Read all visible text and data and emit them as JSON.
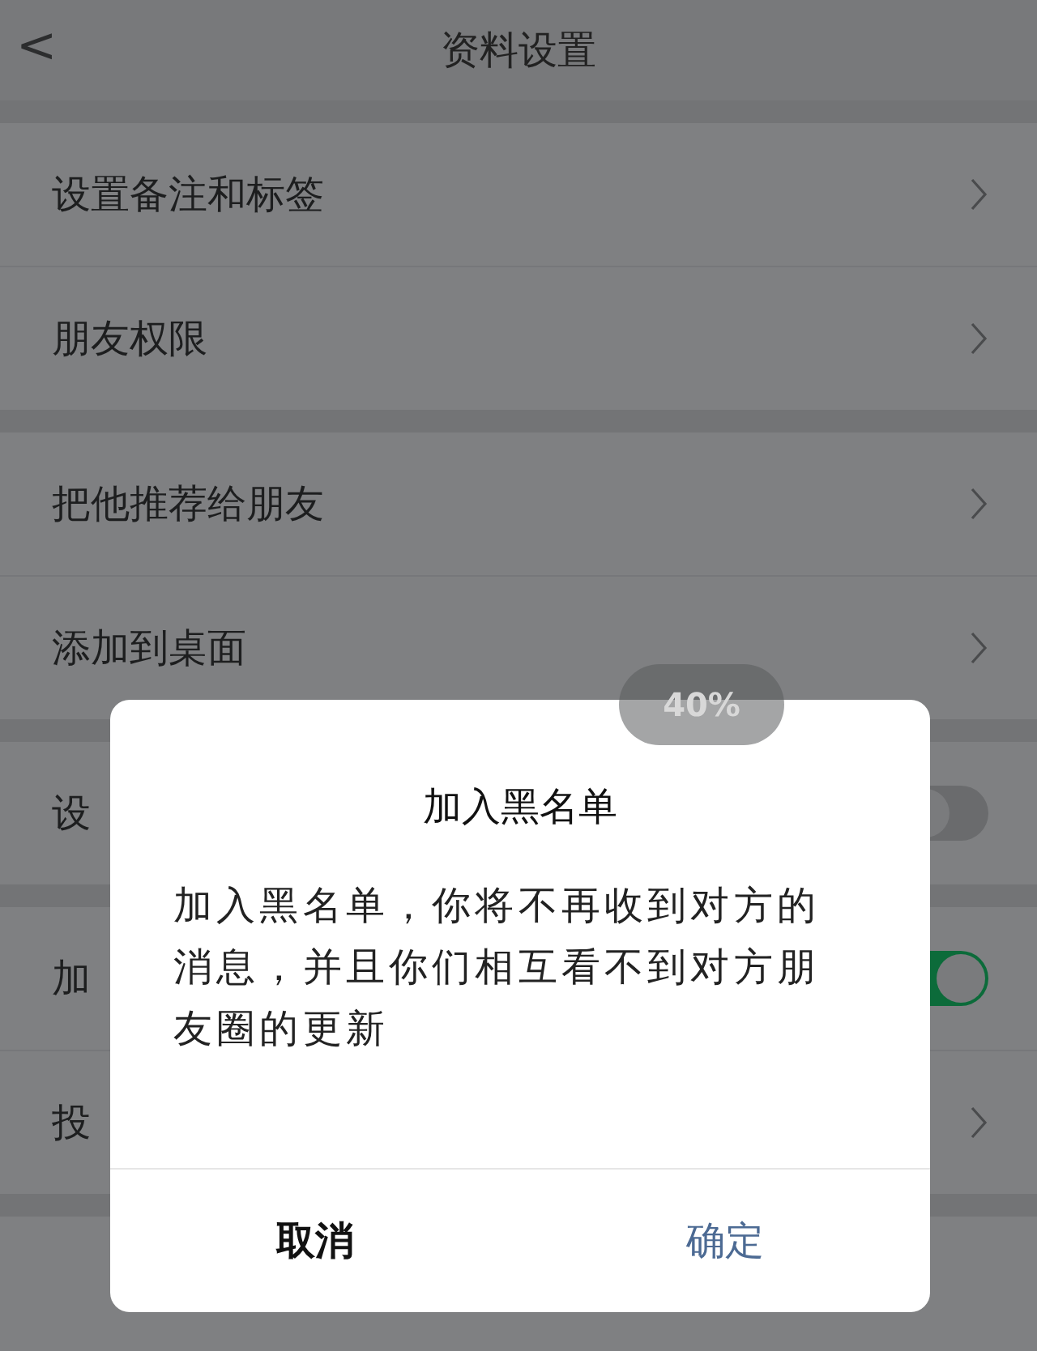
{
  "header": {
    "back": "<",
    "title": "资料设置"
  },
  "sections": [
    {
      "rows": [
        {
          "kind": "link",
          "label": "设置备注和标签"
        },
        {
          "kind": "link",
          "label": "朋友权限"
        }
      ]
    },
    {
      "rows": [
        {
          "kind": "link",
          "label": "把他推荐给朋友"
        },
        {
          "kind": "link",
          "label": "添加到桌面"
        }
      ]
    },
    {
      "rows": [
        {
          "kind": "toggle",
          "label": "设",
          "on": false
        }
      ]
    },
    {
      "rows": [
        {
          "kind": "toggle",
          "label": "加",
          "on": true
        },
        {
          "kind": "link",
          "label": "投"
        }
      ]
    }
  ],
  "zoom_badge": "40%",
  "dialog": {
    "title": "加入黑名单",
    "message": "加入黑名单，你将不再收到对方的消息，并且你们相互看不到对方朋友圈的更新",
    "buttons": [
      {
        "kind": "cancel",
        "label": "取消"
      },
      {
        "kind": "confirm",
        "label": "确定"
      }
    ]
  }
}
